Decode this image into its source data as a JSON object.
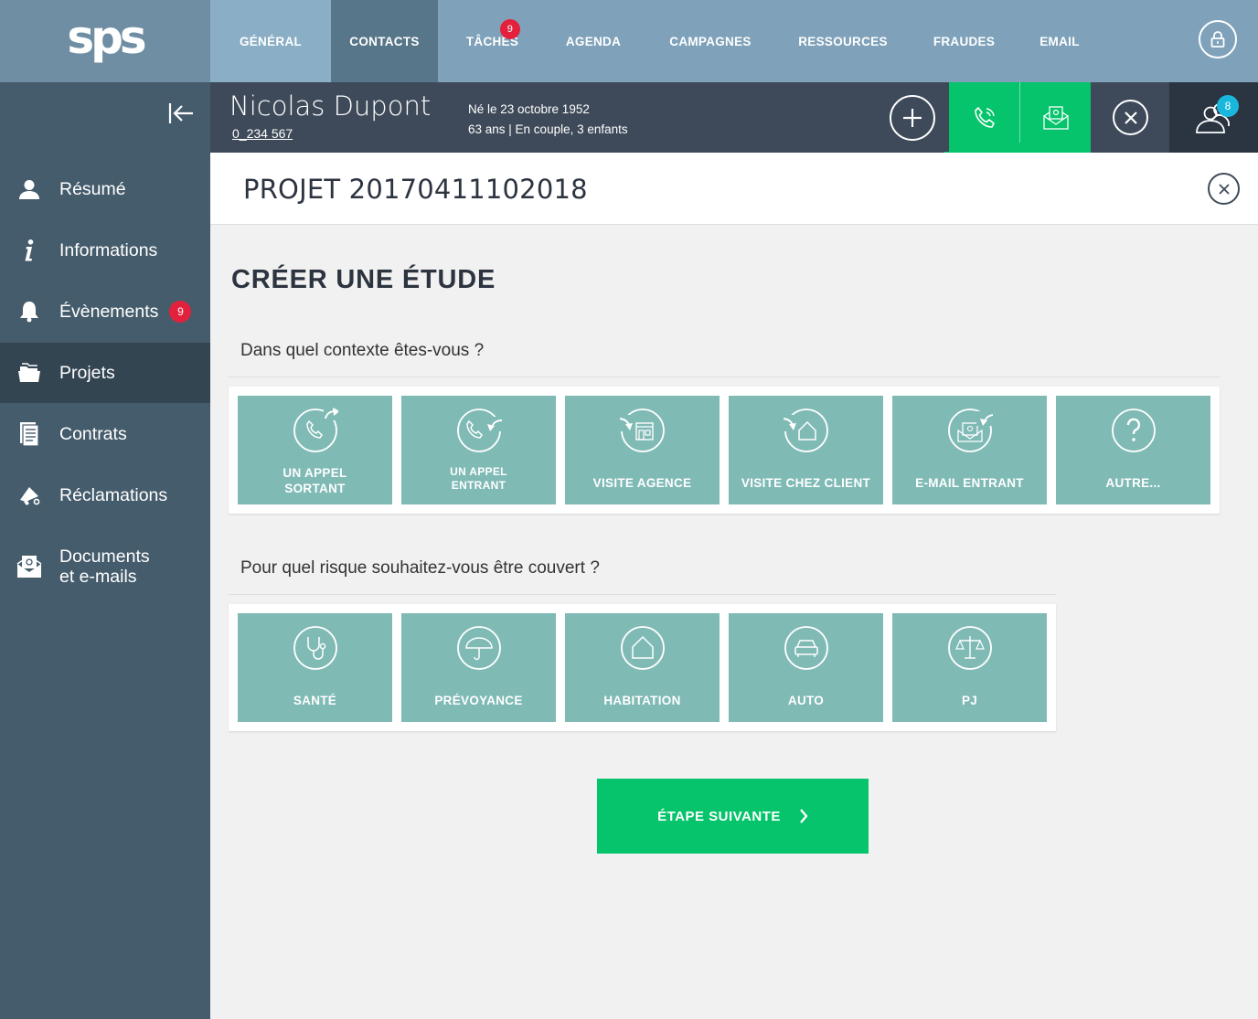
{
  "app": {
    "logo_text": "sps"
  },
  "nav": {
    "items": [
      "GÉNÉRAL",
      "CONTACTS",
      "TÂCHES",
      "AGENDA",
      "CAMPAGNES",
      "RESSOURCES",
      "FRAUDES",
      "EMAIL"
    ],
    "active": "CONTACTS",
    "taches_badge": "9"
  },
  "sidebar": {
    "items": [
      {
        "label": "Résumé",
        "icon": "user-icon"
      },
      {
        "label": "Informations",
        "icon": "info-icon"
      },
      {
        "label": "Évènements",
        "icon": "bell-icon",
        "badge": "9"
      },
      {
        "label": "Projets",
        "icon": "folders-icon"
      },
      {
        "label": "Contrats",
        "icon": "document-icon"
      },
      {
        "label": "Réclamations",
        "icon": "megaphone-icon"
      },
      {
        "label_line1": "Documents",
        "label_line2": "et e-mails",
        "icon": "envelope-icon"
      }
    ],
    "active": "Projets"
  },
  "contact": {
    "name": "Nicolas Dupont",
    "phone": "0_234 567",
    "birth": "Né le 23 octobre 1952",
    "details": "63 ans  |  En couple, 3 enfants",
    "users_badge": "8"
  },
  "project": {
    "title": "PROJET 20170411102018"
  },
  "main": {
    "heading": "CRÉER UNE ÉTUDE",
    "context_question": "Dans quel contexte êtes-vous ?",
    "context_tiles": [
      {
        "line1": "UN APPEL",
        "line2": "SORTANT",
        "icon": "outgoing-call-icon"
      },
      {
        "line1": "UN APPEL",
        "line2": "ENTRANT",
        "icon": "incoming-call-icon"
      },
      {
        "line1": "VISITE AGENCE",
        "icon": "agency-visit-icon"
      },
      {
        "line1": "VISITE CHEZ CLIENT",
        "icon": "home-visit-icon"
      },
      {
        "line1": "E-MAIL ENTRANT",
        "icon": "incoming-email-icon"
      },
      {
        "line1": "AUTRE...",
        "icon": "question-icon"
      }
    ],
    "risk_question": "Pour quel risque souhaitez-vous être couvert ?",
    "risk_tiles": [
      {
        "line1": "SANTÉ",
        "icon": "stethoscope-icon"
      },
      {
        "line1": "PRÉVOYANCE",
        "icon": "umbrella-icon"
      },
      {
        "line1": "HABITATION",
        "icon": "house-icon"
      },
      {
        "line1": "AUTO",
        "icon": "car-icon"
      },
      {
        "line1": "PJ",
        "icon": "scales-icon"
      }
    ],
    "next_label": "ÉTAPE SUIVANTE"
  },
  "colors": {
    "topbar": "#7fa2ba",
    "sidebar": "#455c6c",
    "tile": "#7fbab5",
    "green": "#05c46b",
    "badge_red": "#e3213c",
    "badge_blue": "#1ab7dd"
  }
}
